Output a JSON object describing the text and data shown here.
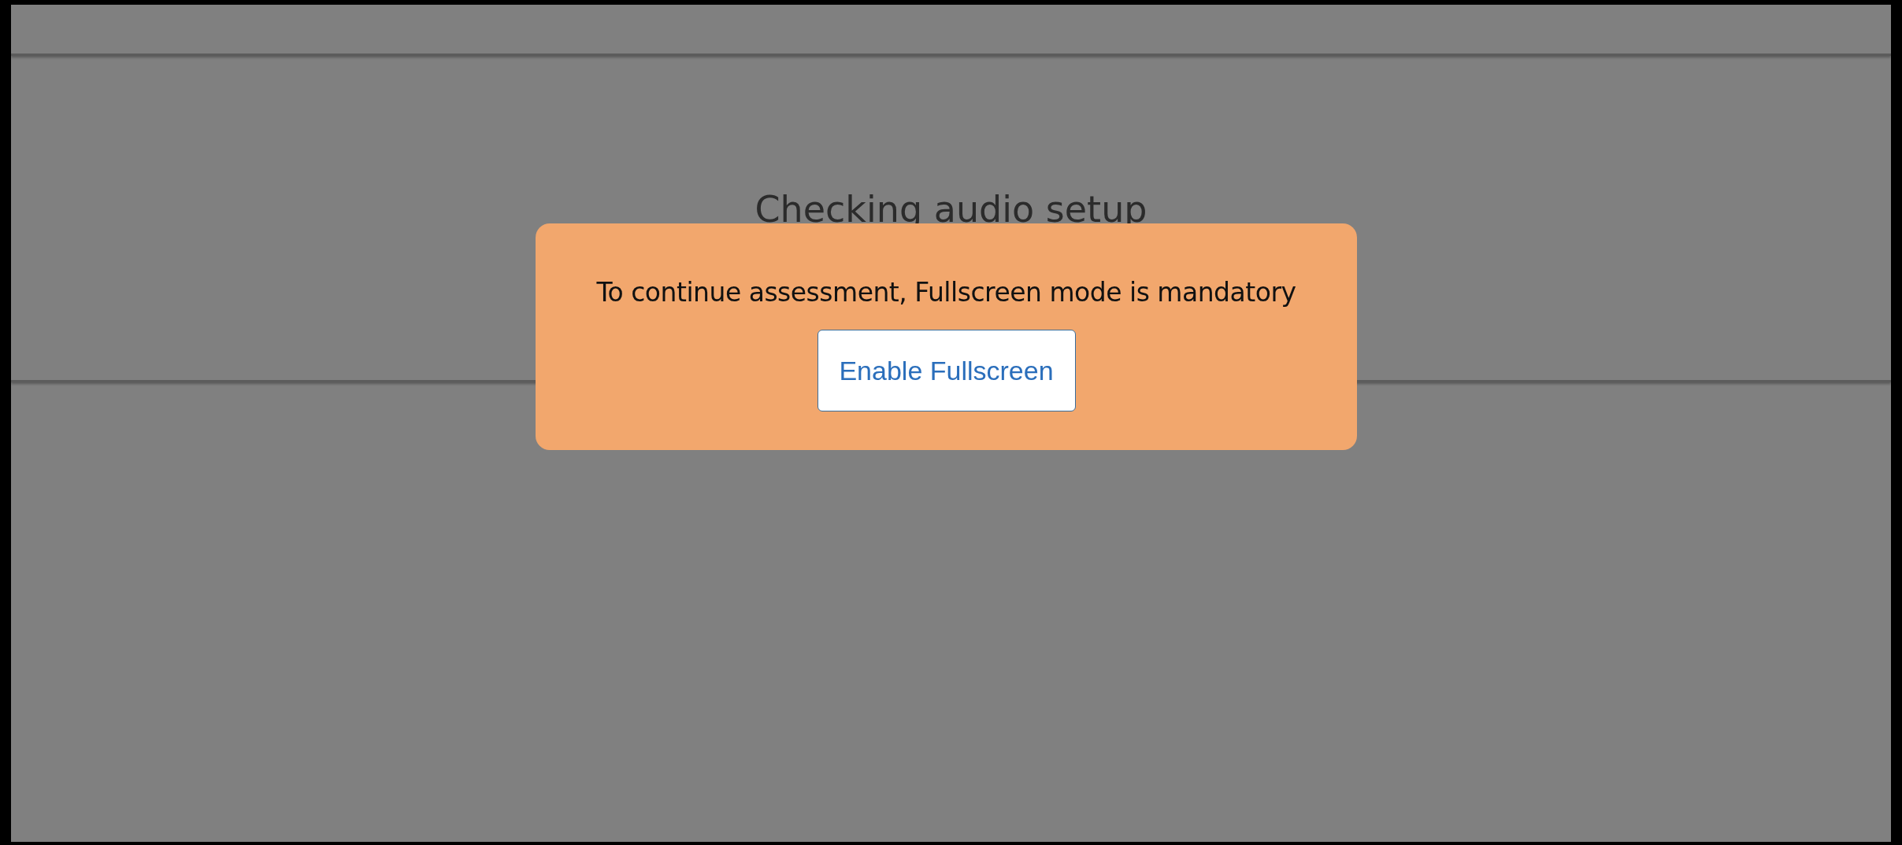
{
  "page": {
    "heading": "Checking audio setup"
  },
  "modal": {
    "message": "To continue assessment, Fullscreen mode is mandatory",
    "button": "Enable Fullscreen"
  }
}
